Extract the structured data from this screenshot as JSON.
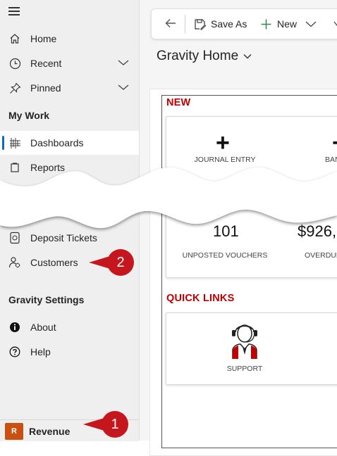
{
  "sidebar": {
    "items": [
      {
        "label": "Home",
        "icon": "home-icon"
      },
      {
        "label": "Recent",
        "icon": "clock-icon"
      },
      {
        "label": "Pinned",
        "icon": "pin-icon"
      }
    ],
    "my_work_header": "My Work",
    "work_items": [
      {
        "label": "Dashboards",
        "icon": "dashboard-icon",
        "selected": true
      },
      {
        "label": "Reports",
        "icon": "reports-icon"
      },
      {
        "label": "Deposit Tickets",
        "icon": "deposit-icon"
      },
      {
        "label": "Customers",
        "icon": "customers-icon"
      }
    ],
    "settings_header": "Gravity Settings",
    "settings_items": [
      {
        "label": "About",
        "icon": "info-icon"
      },
      {
        "label": "Help",
        "icon": "help-icon"
      }
    ],
    "area": {
      "avatar_letter": "R",
      "label": "Revenue",
      "avatar_color": "#ca5010"
    }
  },
  "callouts": [
    {
      "number": "1",
      "color": "#c4161c"
    },
    {
      "number": "2",
      "color": "#c4161c"
    }
  ],
  "toolbar": {
    "save_as_label": "Save As",
    "new_label": "New"
  },
  "page": {
    "title": "Gravity Home"
  },
  "dashboard": {
    "new_section_title": "NEW",
    "new_tiles": [
      {
        "symbol": "+",
        "label": "JOURNAL ENTRY"
      },
      {
        "symbol": "+",
        "label": "BAN"
      }
    ],
    "kpis": [
      {
        "value": "101",
        "label": "UNPOSTED VOUCHERS"
      },
      {
        "value": "$926,",
        "label": "OVERDUE"
      }
    ],
    "quick_links_title": "QUICK LINKS",
    "quick_links": [
      {
        "label": "SUPPORT",
        "icon": "support-agent-icon"
      }
    ]
  },
  "colors": {
    "accent": "#0f6cbd",
    "section_red": "#c00000",
    "callout_red": "#c4161c"
  }
}
